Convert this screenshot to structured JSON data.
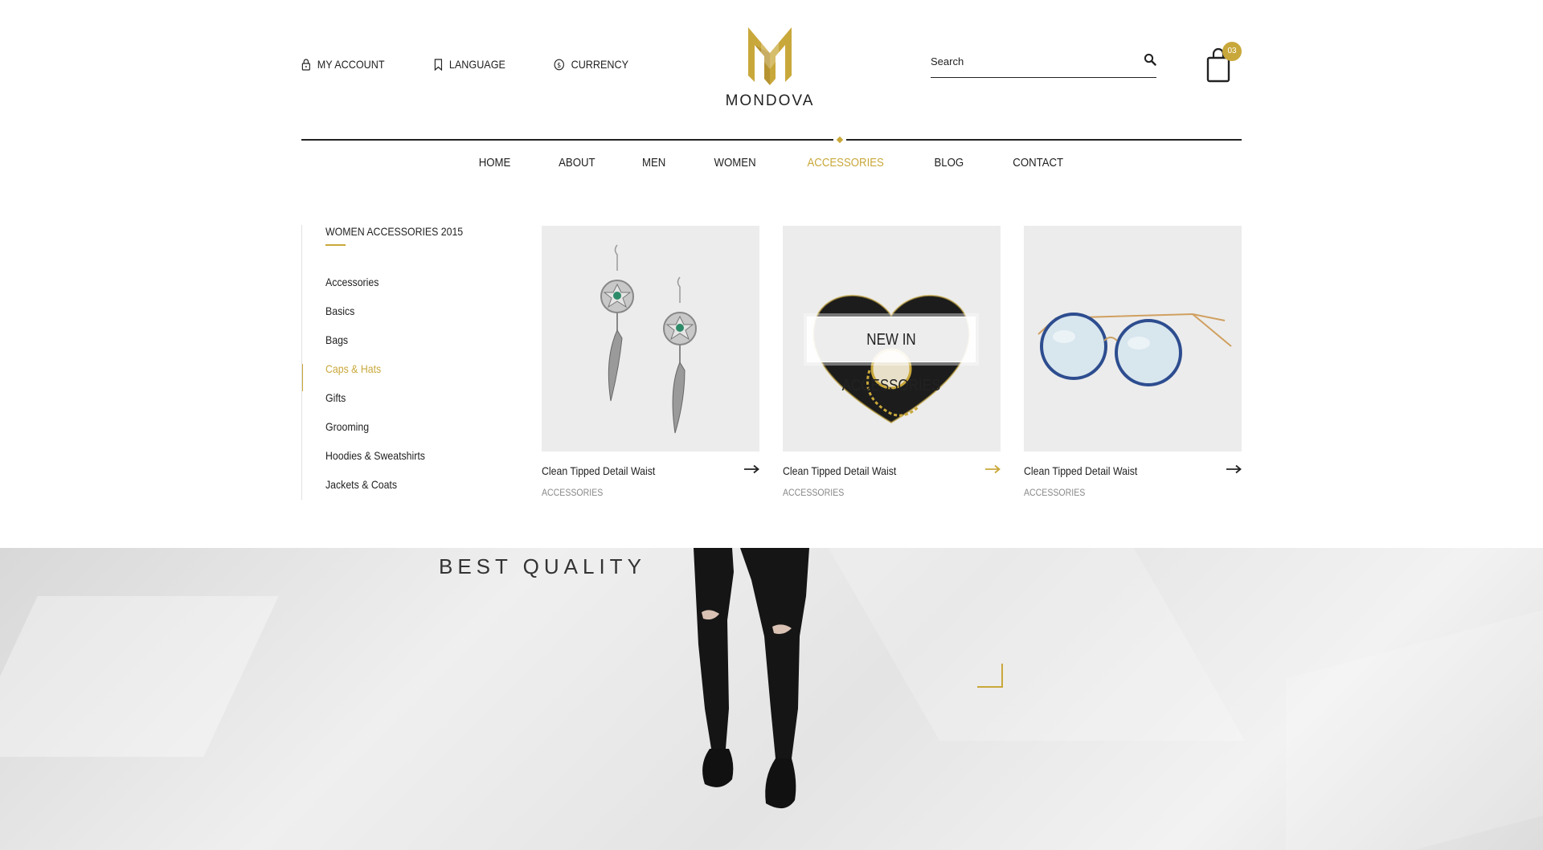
{
  "colors": {
    "accent": "#c9a83b",
    "text": "#222222",
    "muted": "#888888"
  },
  "top_bar": {
    "links": [
      {
        "label": "MY ACCOUNT",
        "icon": "lock-icon"
      },
      {
        "label": "LANGUAGE",
        "icon": "bookmark-icon"
      },
      {
        "label": "CURRENCY",
        "icon": "dollar-circle-icon"
      }
    ]
  },
  "logo": {
    "text": "MONDOVA"
  },
  "search": {
    "placeholder": "Search"
  },
  "cart": {
    "count": "03"
  },
  "nav": {
    "items": [
      "HOME",
      "ABOUT",
      "MEN",
      "WOMEN",
      "ACCESSORIES",
      "BLOG",
      "CONTACT"
    ],
    "active": "ACCESSORIES"
  },
  "mega_menu": {
    "title": "WOMEN ACCESSORIES 2015",
    "categories": [
      "Accessories",
      "Basics",
      "Bags",
      "Caps & Hats",
      "Gifts",
      "Grooming",
      "Hoodies & Sweatshirts",
      "Jackets & Coats"
    ],
    "active_category": "Caps & Hats",
    "products": [
      {
        "name": "Clean Tipped Detail Waist",
        "category": "ACCESSORIES"
      },
      {
        "name": "Clean Tipped Detail Waist",
        "category": "ACCESSORIES",
        "overlay": "NEW IN ACCESSORIES"
      },
      {
        "name": "Clean Tipped Detail Waist",
        "category": "ACCESSORIES"
      }
    ]
  },
  "hero": {
    "tagline": "BEST QUALITY"
  }
}
